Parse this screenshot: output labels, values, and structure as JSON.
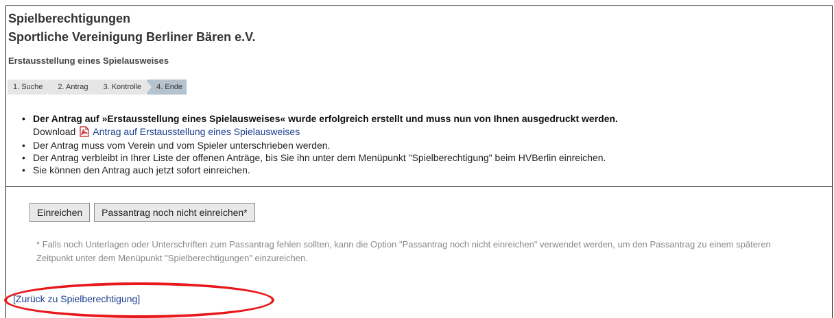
{
  "header": {
    "title": "Spielberechtigungen",
    "club": "Sportliche Vereinigung Berliner Bären e.V.",
    "subtitle": "Erstausstellung eines Spielausweises"
  },
  "steps": [
    {
      "label": "1.  Suche",
      "active": false
    },
    {
      "label": "2.  Antrag",
      "active": false
    },
    {
      "label": "3.  Kontrolle",
      "active": false
    },
    {
      "label": "4.  Ende",
      "active": true
    }
  ],
  "messages": {
    "success": "Der Antrag auf »Erstausstellung eines Spielausweises« wurde erfolgreich erstellt und muss nun von Ihnen ausgedruckt werden.",
    "download_prefix": "Download",
    "download_link": "Antrag auf Erstausstellung eines Spielausweises",
    "bullet1": "Der Antrag muss vom Verein und vom Spieler unterschrieben werden.",
    "bullet2": "Der Antrag verbleibt in Ihrer Liste der offenen Anträge, bis Sie ihn unter dem Menüpunkt \"Spielberechtigung\" beim HVBerlin einreichen.",
    "bullet3": "Sie können den Antrag auch jetzt sofort einreichen."
  },
  "buttons": {
    "submit": "Einreichen",
    "defer": "Passantrag noch nicht einreichen*"
  },
  "note": "* Falls noch Unterlagen oder Unterschriften zum Passantrag fehlen sollten, kann die Option \"Passantrag noch nicht einreichen\" verwendet werden, um den Passantrag zu einem späteren Zeitpunkt unter dem Menüpunkt \"Spielberechtigungen\" einzureichen.",
  "back_link": "[Zurück zu Spielberechtigung]",
  "icons": {
    "pdf": "pdf-icon"
  },
  "colors": {
    "link": "#1a3d8f",
    "active_step": "#b5c3cf",
    "highlight": "#e8191c"
  }
}
